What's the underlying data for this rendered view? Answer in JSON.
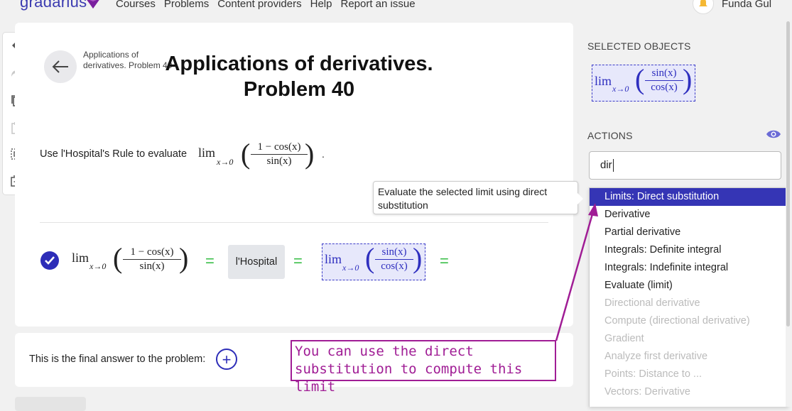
{
  "header": {
    "logo_text": "gradarius",
    "nav": [
      "Courses",
      "Problems",
      "Content providers",
      "Help",
      "Report an issue"
    ],
    "user_name": "Funda Gul"
  },
  "problem": {
    "breadcrumb": "Applications of derivatives. Problem 40",
    "title": "Applications of derivatives. Problem 40",
    "statement": "Use l'Hospital's Rule to evaluate",
    "statement_end": ".",
    "expr_lim": "lim",
    "expr_sub": "x→0",
    "expr_num": "1 − cos(x)",
    "expr_den": "sin(x)"
  },
  "step": {
    "lim": "lim",
    "sub": "x→0",
    "num": "1 − cos(x)",
    "den": "sin(x)",
    "eq": "=",
    "rule": "l'Hospital",
    "result_num": "sin(x)",
    "result_den": "cos(x)"
  },
  "answer": {
    "label": "This is the final answer to the problem:",
    "plus": "+"
  },
  "annotation": {
    "line1": "You can use the direct",
    "line2": "substitution to compute this limit"
  },
  "tooltip": {
    "text": "Evaluate the selected limit using direct substitution"
  },
  "panel": {
    "selected_label": "SELECTED OBJECTS",
    "selected_lim": "lim",
    "selected_sub": "x→0",
    "selected_num": "sin(x)",
    "selected_den": "cos(x)",
    "actions_label": "ACTIONS",
    "search_value": "dir",
    "menu": [
      {
        "label": "Limits: Direct substitution",
        "state": "active"
      },
      {
        "label": "Derivative",
        "state": "enabled"
      },
      {
        "label": "Partial derivative",
        "state": "enabled"
      },
      {
        "label": "Integrals: Definite integral",
        "state": "enabled"
      },
      {
        "label": "Integrals: Indefinite integral",
        "state": "enabled"
      },
      {
        "label": "Evaluate (limit)",
        "state": "enabled"
      },
      {
        "label": "Directional derivative",
        "state": "disabled"
      },
      {
        "label": "Compute (directional derivative)",
        "state": "disabled"
      },
      {
        "label": "Gradient",
        "state": "disabled"
      },
      {
        "label": "Analyze first derivative",
        "state": "disabled"
      },
      {
        "label": "Points: Distance to ...",
        "state": "disabled"
      },
      {
        "label": "Vectors: Derivative",
        "state": "disabled"
      }
    ]
  },
  "colors": {
    "accent": "#2d2db8",
    "annotation": "#a01d95",
    "equals": "#3bbf4a",
    "selection": "#3c3cc8"
  },
  "toolbar_icons": [
    "undo-icon",
    "redo-icon",
    "copy-icon",
    "paste-icon",
    "select-all-icon",
    "add-box-icon"
  ]
}
